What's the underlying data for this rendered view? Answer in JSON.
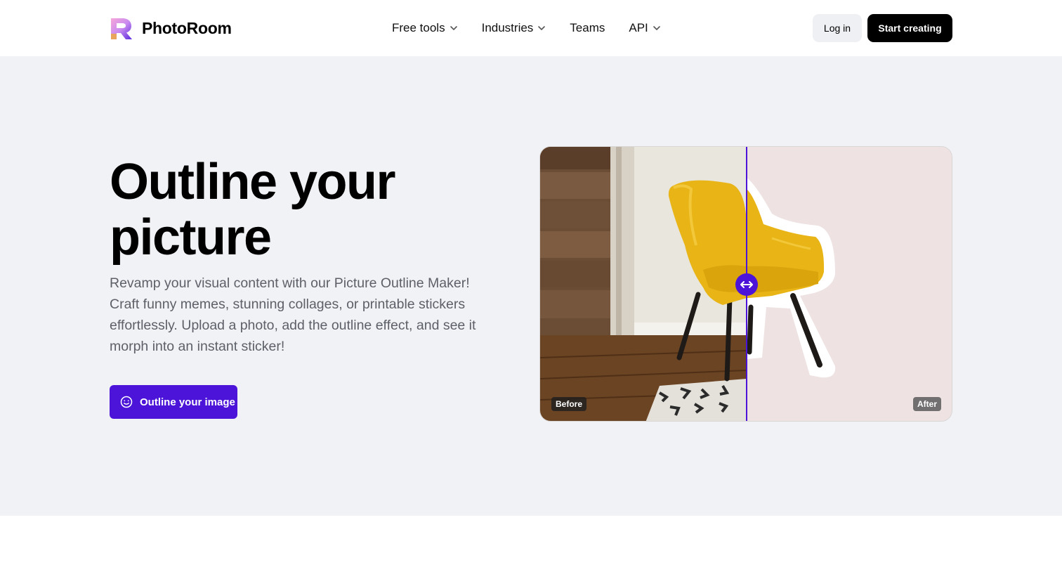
{
  "brand": {
    "name": "PhotoRoom",
    "icon": "photoroom-logo-icon"
  },
  "nav": {
    "items": [
      {
        "label": "Free tools",
        "has_dropdown": true
      },
      {
        "label": "Industries",
        "has_dropdown": true
      },
      {
        "label": "Teams",
        "has_dropdown": false
      },
      {
        "label": "API",
        "has_dropdown": true
      }
    ]
  },
  "header_actions": {
    "login_label": "Log in",
    "start_label": "Start creating"
  },
  "hero": {
    "title": "Outline your picture",
    "description": "Revamp your visual content with our Picture Outline Maker! Craft funny memes, stunning collages, or printable stickers effortlessly. Upload a photo, add the outline effect, and see it morph into an instant sticker!",
    "cta_label": "Outline your image",
    "cta_icon": "smile-icon"
  },
  "comparison": {
    "before_label": "Before",
    "after_label": "After",
    "handle_icon": "left-right-arrow-icon",
    "slider_position": 0.5
  },
  "colors": {
    "accent": "#4b14d8",
    "hero_bg": "#f1f2f5",
    "after_bg": "#eee2e2"
  }
}
